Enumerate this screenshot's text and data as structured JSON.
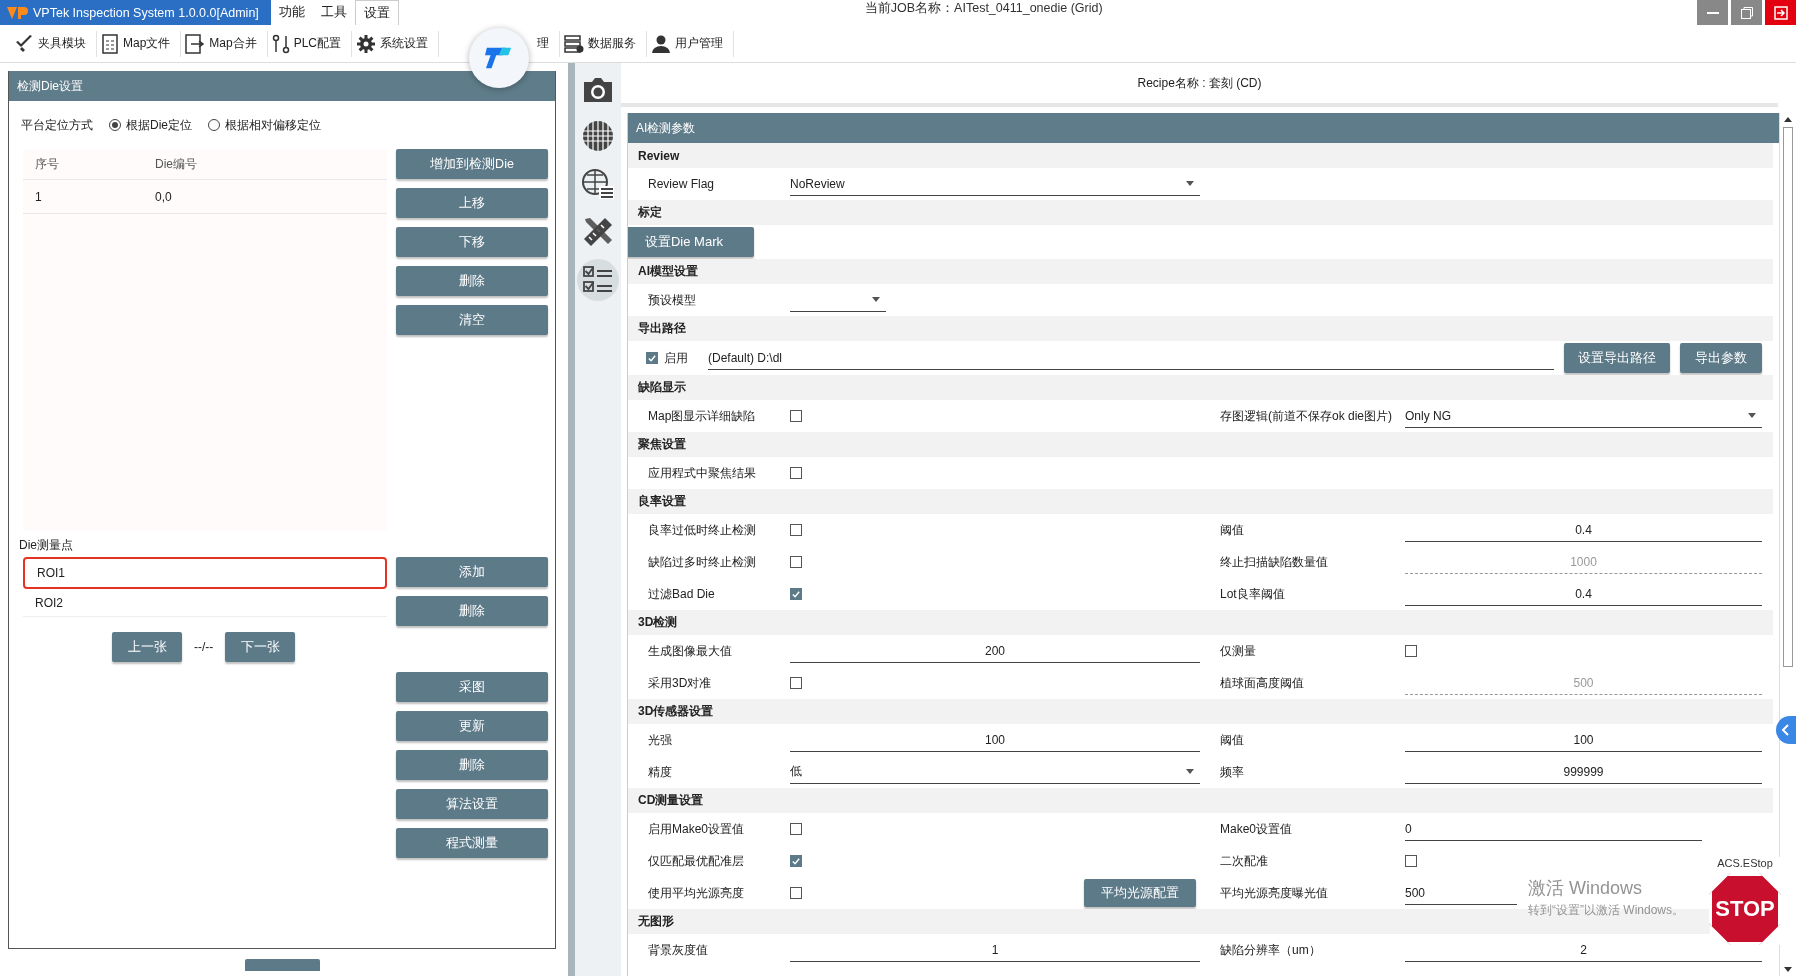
{
  "window": {
    "app_title": "VPTek Inspection System 1.0.0.0[Admin]",
    "job": "当前JOB名称：AITest_0411_onedie (Grid)",
    "menus": [
      {
        "label": "功能",
        "selected": false
      },
      {
        "label": "工具",
        "selected": false
      },
      {
        "label": "设置",
        "selected": true
      }
    ]
  },
  "toolbar": [
    {
      "label": "夹具模块"
    },
    {
      "label": "Map文件"
    },
    {
      "label": "Map合并"
    },
    {
      "label": "PLC配置"
    },
    {
      "label": "系统设置"
    },
    {
      "label": "理"
    },
    {
      "label": "数据服务"
    },
    {
      "label": "用户管理"
    }
  ],
  "left_panel": {
    "title": "检测Die设置",
    "positioning": {
      "label": "平台定位方式",
      "options": [
        {
          "label": "根据Die定位",
          "selected": true
        },
        {
          "label": "根据相对偏移定位",
          "selected": false
        }
      ]
    },
    "table": {
      "columns": [
        "序号",
        "Die编号"
      ],
      "rows": [
        [
          "1",
          "0,0"
        ]
      ]
    },
    "table_buttons": [
      "增加到检测Die",
      "上移",
      "下移",
      "删除",
      "清空"
    ],
    "roi_label": "Die测量点",
    "rois": [
      {
        "label": "ROI1",
        "selected": true
      },
      {
        "label": "ROI2",
        "selected": false
      }
    ],
    "roi_buttons": [
      "添加",
      "删除"
    ],
    "pager": {
      "prev": "上一张",
      "page": "--/--",
      "next": "下一张"
    },
    "action_buttons": [
      "采图",
      "更新",
      "删除",
      "算法设置",
      "程式测量"
    ]
  },
  "recipe": "Recipe名称 : 套刻 (CD)",
  "params": {
    "title": "AI检测参数",
    "sections": [
      {
        "title": "Review",
        "rows": [
          {
            "left": {
              "kind": "select",
              "label": "Review Flag",
              "value": "NoReview"
            }
          }
        ]
      },
      {
        "title": "标定",
        "rows": [
          {
            "left": {
              "kind": "button",
              "label": "设置Die Mark"
            }
          }
        ]
      },
      {
        "title": "AI模型设置",
        "rows": [
          {
            "left": {
              "kind": "select",
              "label": "预设模型"
            }
          }
        ]
      },
      {
        "title": "导出路径",
        "rows": [
          {
            "left": {
              "kind": "path",
              "label": "启用",
              "checked": true,
              "value": "(Default) D:\\dl",
              "buttons": [
                "设置导出路径",
                "导出参数"
              ]
            }
          }
        ]
      },
      {
        "title": "缺陷显示",
        "rows": [
          {
            "left": {
              "kind": "check",
              "label": "Map图显示详细缺陷",
              "checked": false
            },
            "right": {
              "kind": "select",
              "label": "存图逻辑(前道不保存ok die图片)",
              "value": "Only NG"
            }
          }
        ]
      },
      {
        "title": "聚焦设置",
        "rows": [
          {
            "left": {
              "kind": "check",
              "label": "应用程式中聚焦结果",
              "checked": false
            }
          }
        ]
      },
      {
        "title": "良率设置",
        "rows": [
          {
            "left": {
              "kind": "check",
              "label": "良率过低时终止检测",
              "checked": false
            },
            "right": {
              "kind": "field",
              "label": "阈值",
              "value": "0.4",
              "disabled": false
            }
          },
          {
            "left": {
              "kind": "check",
              "label": "缺陷过多时终止检测",
              "checked": false
            },
            "right": {
              "kind": "field",
              "label": "终止扫描缺陷数量值",
              "value": "1000",
              "disabled": true
            }
          },
          {
            "left": {
              "kind": "check",
              "label": "过滤Bad Die",
              "checked": true
            },
            "right": {
              "kind": "field",
              "label": "Lot良率阈值",
              "value": "0.4",
              "disabled": false
            }
          }
        ]
      },
      {
        "title": "3D检测",
        "rows": [
          {
            "left": {
              "kind": "field",
              "label": "生成图像最大值",
              "value": "200",
              "disabled": false
            },
            "right": {
              "kind": "check",
              "label": "仅测量",
              "checked": false
            }
          },
          {
            "left": {
              "kind": "check",
              "label": "采用3D对准",
              "checked": false
            },
            "right": {
              "kind": "field",
              "label": "植球面高度阈值",
              "value": "500",
              "disabled": true
            }
          }
        ]
      },
      {
        "title": "3D传感器设置",
        "rows": [
          {
            "left": {
              "kind": "field",
              "label": "光强",
              "value": "100",
              "disabled": false
            },
            "right": {
              "kind": "field",
              "label": "阈值",
              "value": "100",
              "disabled": false
            }
          },
          {
            "left": {
              "kind": "select",
              "label": "精度",
              "value": "低"
            },
            "right": {
              "kind": "field",
              "label": "频率",
              "value": "999999",
              "disabled": false
            }
          }
        ]
      },
      {
        "title": "CD测量设置",
        "rows": [
          {
            "left": {
              "kind": "check",
              "label": "启用Make0设置值",
              "checked": false
            },
            "right": {
              "kind": "entry",
              "label": "Make0设置值",
              "value": "0"
            }
          },
          {
            "left": {
              "kind": "check",
              "label": "仅匹配最优配准层",
              "checked": true
            },
            "right": {
              "kind": "check",
              "label": "二次配准",
              "checked": false
            }
          },
          {
            "left": {
              "kind": "check",
              "label": "使用平均光源亮度",
              "checked": false,
              "button": "平均光源配置"
            },
            "right": {
              "kind": "entry",
              "label": "平均光源亮度曝光值",
              "value": "500"
            }
          }
        ]
      },
      {
        "title": "无图形",
        "rows": [
          {
            "left": {
              "kind": "field",
              "label": "背景灰度值",
              "value": "1",
              "disabled": false
            },
            "right": {
              "kind": "field",
              "label": "缺陷分辨率（um）",
              "value": "2",
              "disabled": false
            }
          }
        ]
      }
    ]
  },
  "windows_notice": {
    "title": "激活 Windows",
    "hint": "转到“设置”以激活 Windows。"
  },
  "estop": {
    "label": "ACS.EStop",
    "sign": "STOP"
  }
}
